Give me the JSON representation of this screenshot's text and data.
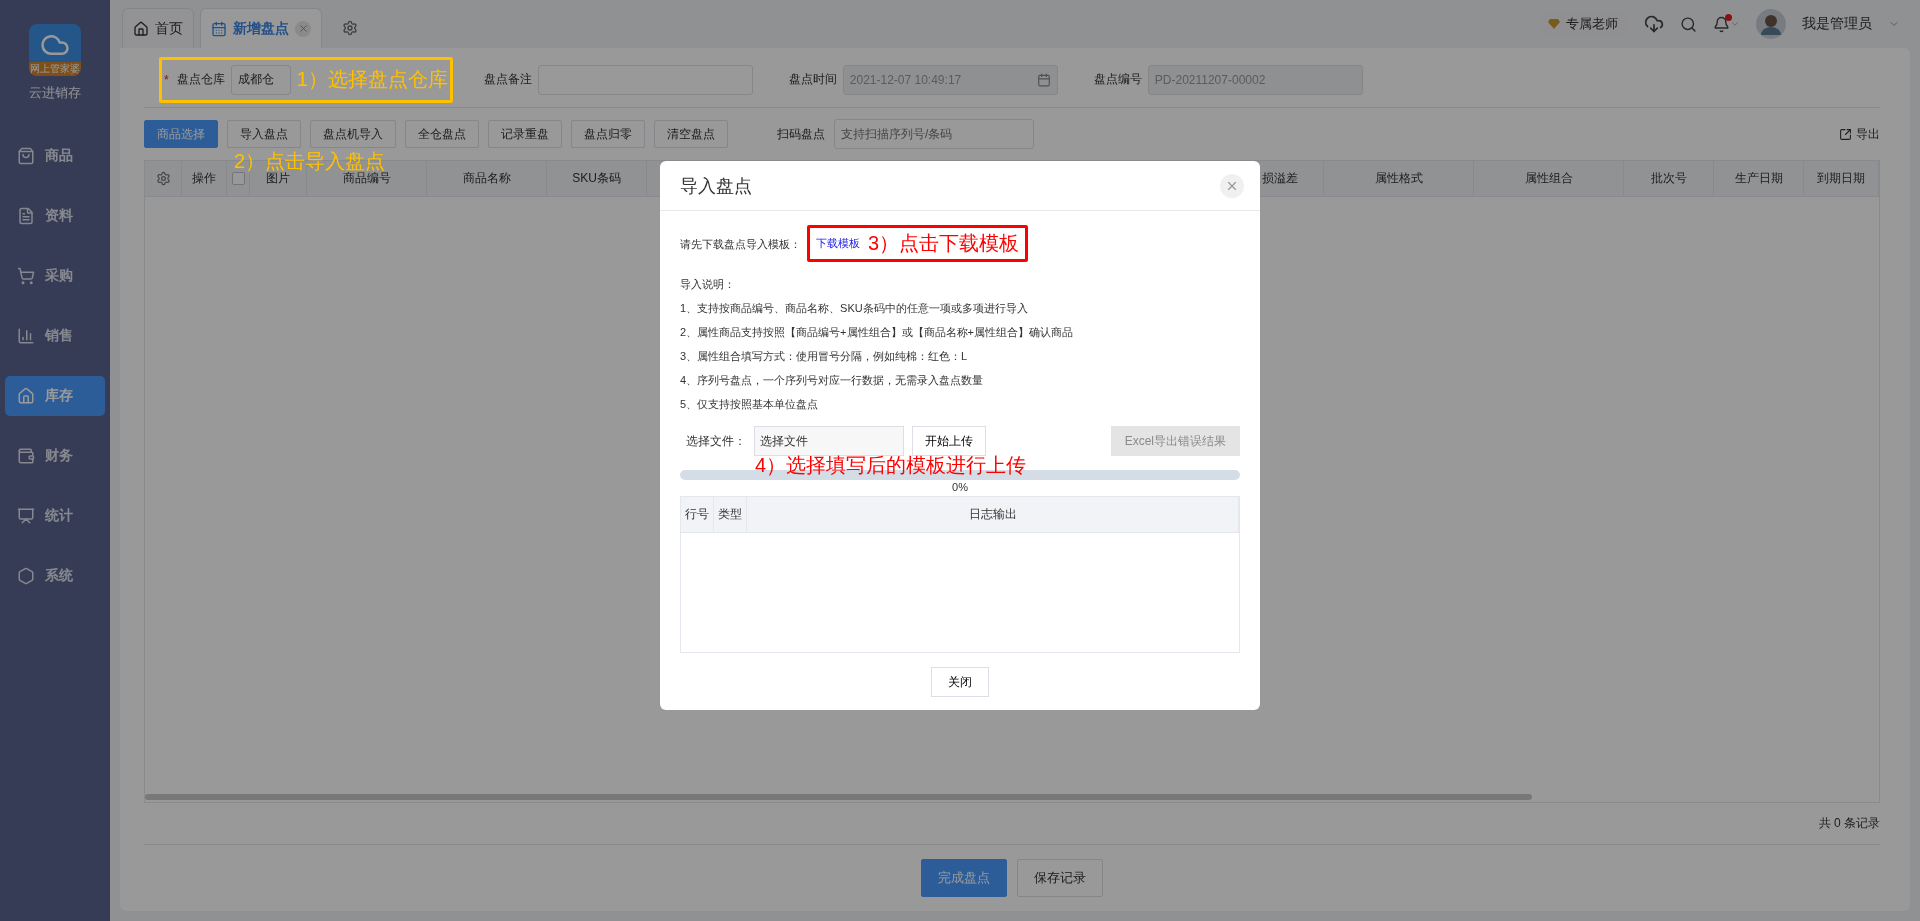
{
  "logo": {
    "banner": "网上管家婆",
    "app_name": "云进销存"
  },
  "sidebar": {
    "items": [
      {
        "label": "商品",
        "selected": false
      },
      {
        "label": "资料",
        "selected": false
      },
      {
        "label": "采购",
        "selected": false
      },
      {
        "label": "销售",
        "selected": false
      },
      {
        "label": "库存",
        "selected": true
      },
      {
        "label": "财务",
        "selected": false
      },
      {
        "label": "统计",
        "selected": false
      },
      {
        "label": "系统",
        "selected": false
      }
    ]
  },
  "tabs": [
    {
      "label": "首页",
      "selected": false,
      "closable": false
    },
    {
      "label": "新增盘点",
      "selected": true,
      "closable": true
    }
  ],
  "header": {
    "teacher_badge": "专属老师",
    "notification_unread": true,
    "user_name": "我是管理员"
  },
  "form": {
    "fields": [
      {
        "required_mark": "*",
        "label": "盘点仓库",
        "value": "成都仓",
        "annotation": {
          "text": "1）选择盘点仓库",
          "color": "#ffc000"
        }
      },
      {
        "label": "盘点备注"
      },
      {
        "label": "盘点时间",
        "value": "2021-12-07 10:49:17",
        "disabled": true,
        "calendar": true
      },
      {
        "label": "盘点编号",
        "value": "PD-20211207-00002",
        "disabled": true
      }
    ]
  },
  "toolbar": {
    "buttons": [
      {
        "label": "商品选择",
        "primary": true
      },
      {
        "label": "导入盘点",
        "primary": false
      },
      {
        "label": "盘点机导入",
        "primary": false
      },
      {
        "label": "全仓盘点",
        "primary": false
      },
      {
        "label": "记录重盘",
        "primary": false
      },
      {
        "label": "盘点归零",
        "primary": false
      },
      {
        "label": "清空盘点",
        "primary": false
      }
    ],
    "annotation": {
      "text": "2）点击导入盘点",
      "color": "#ffc000"
    },
    "scan": {
      "label": "扫码盘点",
      "placeholder": "支持扫描序列号/条码"
    },
    "export": "导出"
  },
  "table": {
    "select_all_checked": false,
    "columns_left": [
      {
        "label": "操作"
      },
      {
        "label": "图片"
      },
      {
        "label": "商品编号"
      },
      {
        "label": "商品名称"
      },
      {
        "label": "SKU条码"
      }
    ],
    "columns_right": [
      {
        "label": "损溢差"
      },
      {
        "label": "属性格式"
      },
      {
        "label": "属性组合"
      },
      {
        "label": "批次号"
      },
      {
        "label": "生产日期"
      },
      {
        "label": "到期日期"
      }
    ],
    "record_count": "共 0 条记录"
  },
  "footer": {
    "buttons": [
      {
        "label": "完成盘点",
        "primary": true
      },
      {
        "label": "保存记录",
        "primary": false
      }
    ]
  },
  "modal": {
    "title": "导入盘点",
    "template_prompt": "请先下载盘点导入模板：",
    "template_link": "下载模板",
    "template_annotation": {
      "text": "3）点击下载模板",
      "color": "#ff0000"
    },
    "instructions_title": "导入说明：",
    "instructions": [
      "1、支持按商品编号、商品名称、SKU条码中的任意一项或多项进行导入",
      "2、属性商品支持按照【商品编号+属性组合】或【商品名称+属性组合】确认商品",
      "3、属性组合填写方式：使用冒号分隔，例如纯棉：红色：L",
      "4、序列号盘点，一个序列号对应一行数据，无需录入盘点数量",
      "5、仅支持按照基本单位盘点"
    ],
    "file_label": "选择文件：",
    "file_field": "选择文件",
    "upload_button": "开始上传",
    "export_errors_button": {
      "label": "Excel导出错误结果",
      "disabled": true
    },
    "upload_annotation": {
      "text": "4）选择填写后的模板进行上传",
      "color": "#ff0000"
    },
    "progress": {
      "level": 0,
      "label": "0%"
    },
    "log_columns": [
      {
        "label": "行号"
      },
      {
        "label": "类型"
      },
      {
        "label": "日志输出"
      }
    ],
    "close_button": "关闭"
  }
}
